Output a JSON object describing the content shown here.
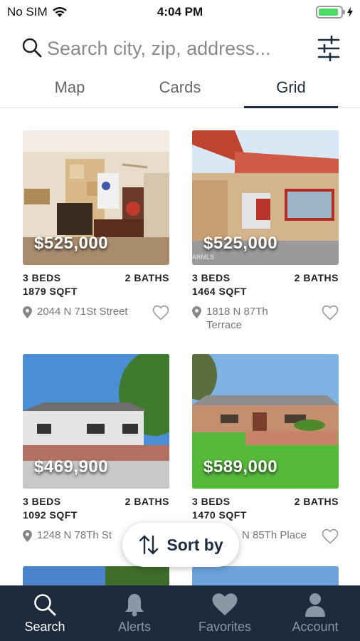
{
  "status_bar": {
    "carrier": "No SIM",
    "time": "4:04 PM",
    "battery_level": 0.9,
    "colors": {
      "battery": "#4cd964"
    }
  },
  "search": {
    "placeholder": "Search city, zip, address...",
    "value": ""
  },
  "view_tabs": {
    "items": [
      {
        "label": "Map",
        "active": false
      },
      {
        "label": "Cards",
        "active": false
      },
      {
        "label": "Grid",
        "active": true
      }
    ]
  },
  "listings": [
    {
      "price": "$525,000",
      "beds": "3 BEDS",
      "baths": "2 BATHS",
      "sqft": "1879 SQFT",
      "address": "2044 N 71St Street",
      "watermark": "",
      "favorited": false
    },
    {
      "price": "$525,000",
      "beds": "3 BEDS",
      "baths": "2 BATHS",
      "sqft": "1464 SQFT",
      "address": "1818 N 87Th Terrace",
      "watermark": "ARMLS",
      "favorited": false
    },
    {
      "price": "$469,900",
      "beds": "3 BEDS",
      "baths": "2 BATHS",
      "sqft": "1092 SQFT",
      "address": "1248 N 78Th St",
      "watermark": "",
      "favorited": false
    },
    {
      "price": "$589,000",
      "beds": "3 BEDS",
      "baths": "2 BATHS",
      "sqft": "1470 SQFT",
      "address": "N 85Th Place",
      "watermark": "",
      "favorited": false
    }
  ],
  "sort_button": {
    "label": "Sort by",
    "icon": "sort-arrows-icon"
  },
  "bottom_nav": {
    "items": [
      {
        "label": "Search",
        "icon": "search-icon",
        "active": true
      },
      {
        "label": "Alerts",
        "icon": "bell-icon",
        "active": false
      },
      {
        "label": "Favorites",
        "icon": "heart-icon",
        "active": false
      },
      {
        "label": "Account",
        "icon": "person-icon",
        "active": false
      }
    ]
  },
  "colors": {
    "primary_navy": "#1e2b3c",
    "inactive_nav": "#8c97a6",
    "muted_text": "#777777"
  }
}
